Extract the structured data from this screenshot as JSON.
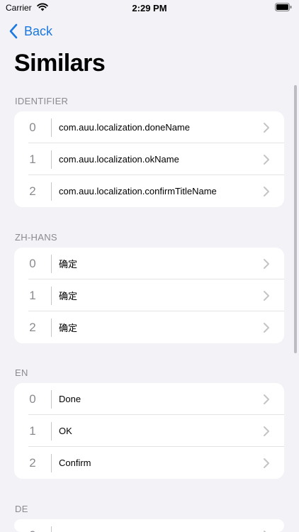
{
  "status_bar": {
    "carrier": "Carrier",
    "time": "2:29 PM"
  },
  "nav": {
    "back_label": "Back"
  },
  "title": "Similars",
  "colors": {
    "accent": "#1a78e0",
    "background": "#f2f2f7",
    "secondary_text": "#8a8a8f"
  },
  "sections": [
    {
      "header": "IDENTIFIER",
      "rows": [
        {
          "index": "0",
          "text": "com.auu.localization.doneName"
        },
        {
          "index": "1",
          "text": "com.auu.localization.okName"
        },
        {
          "index": "2",
          "text": "com.auu.localization.confirmTitleName"
        }
      ]
    },
    {
      "header": "ZH-HANS",
      "rows": [
        {
          "index": "0",
          "text": "确定"
        },
        {
          "index": "1",
          "text": "确定"
        },
        {
          "index": "2",
          "text": "确定"
        }
      ]
    },
    {
      "header": "EN",
      "rows": [
        {
          "index": "0",
          "text": "Done"
        },
        {
          "index": "1",
          "text": "OK"
        },
        {
          "index": "2",
          "text": "Confirm"
        }
      ]
    },
    {
      "header": "DE",
      "rows": [
        {
          "index": "0",
          "text": ""
        }
      ]
    }
  ]
}
